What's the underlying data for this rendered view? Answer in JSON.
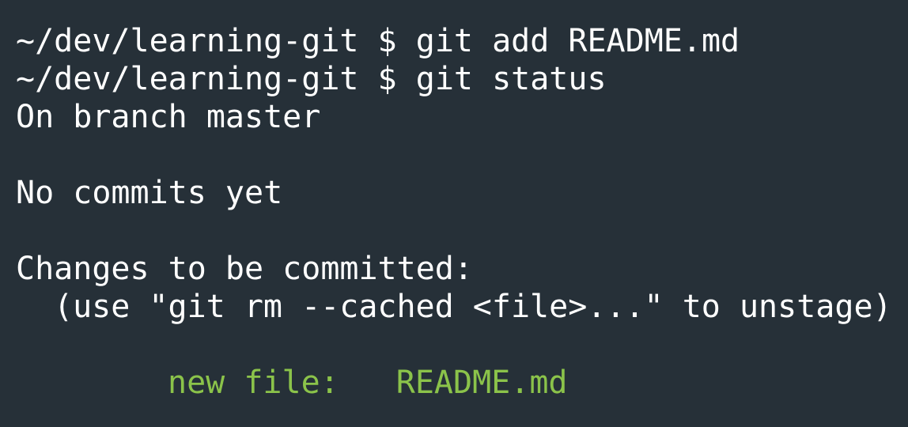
{
  "colors": {
    "background": "#263038",
    "text": "#ffffff",
    "staged": "#8bc34a"
  },
  "terminal": {
    "lines": [
      {
        "prompt": "~/dev/learning-git $ ",
        "command": "git add README.md"
      },
      {
        "prompt": "~/dev/learning-git $ ",
        "command": "git status"
      }
    ],
    "output": {
      "branch": "On branch master",
      "no_commits": "No commits yet",
      "changes_header": "Changes to be committed:",
      "hint": "(use \"git rm --cached <file>...\" to unstage)",
      "staged_label": "new file:",
      "staged_file": "README.md"
    }
  }
}
